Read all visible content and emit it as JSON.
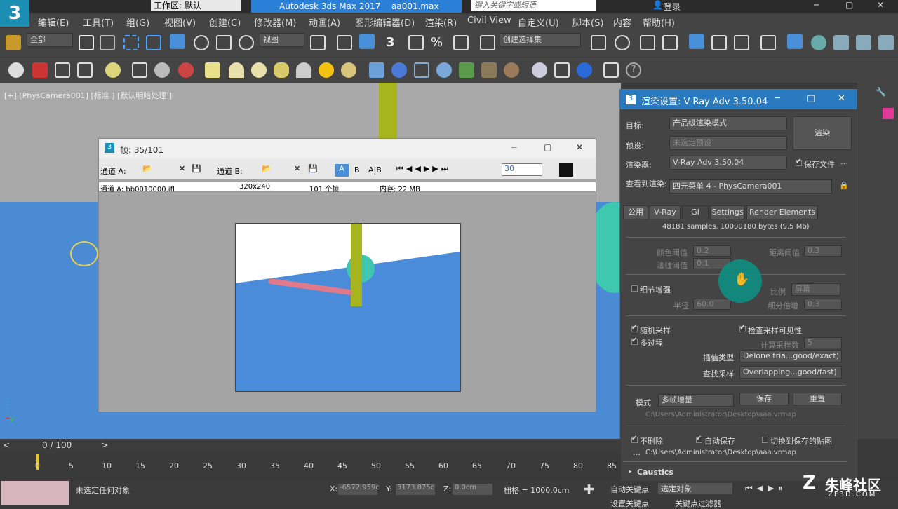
{
  "titlebar": {
    "workspace_label": "工作区: 默认",
    "app_title": "Autodesk 3ds Max 2017",
    "file": "aa001.max",
    "search_placeholder": "键入关键字或短语",
    "login": "登录"
  },
  "menu": [
    "编辑(E)",
    "工具(T)",
    "组(G)",
    "视图(V)",
    "创建(C)",
    "修改器(M)",
    "动画(A)",
    "图形编辑器(D)",
    "渲染(R)",
    "Civil View",
    "自定义(U)",
    "脚本(S)",
    "内容",
    "帮助(H)"
  ],
  "toolbar": {
    "filter": "全部",
    "ref_coord": "视图",
    "selection_set": "创建选择集"
  },
  "viewport": {
    "label": "[+] [PhysCamera001] [标准 ] [默认明暗处理 ]"
  },
  "frame_window": {
    "title": "帧: 35/101",
    "channel_a": "通道 A:",
    "channel_b": "通道 B:",
    "btn_a": "A",
    "btn_b": "B",
    "btn_ab": "A|B",
    "frame_num": "30",
    "info_file": "通道 A: bb0010000.ifl",
    "info_res": "320x240",
    "info_frames": "101 个帧",
    "info_mem": "内存: 22 MB"
  },
  "render_dialog": {
    "title": "渲染设置: V-Ray Adv 3.50.04",
    "target_label": "目标:",
    "target_value": "产品级渲染模式",
    "preset_label": "预设:",
    "preset_value": "未选定预设",
    "renderer_label": "渲染器:",
    "renderer_value": "V-Ray Adv 3.50.04",
    "save_file": "保存文件",
    "view_label": "查看到渲染:",
    "view_value": "四元菜单 4 - PhysCamera001",
    "render_button": "渲染",
    "tabs": [
      "公用",
      "V-Ray",
      "GI",
      "Settings",
      "Render Elements"
    ],
    "samples_text": "48181 samples, 10000180 bytes (9.5 Mb)",
    "color_thresh_label": "颜色阈值",
    "color_thresh": "0.2",
    "dist_thresh_label": "距离阈值",
    "dist_thresh": "0.3",
    "normal_thresh_label": "法线阈值",
    "normal_thresh": "0.1",
    "detail_enh": "细节增强",
    "scale_label": "比例",
    "scale_value": "屏幕",
    "radius_label": "半径",
    "radius": "60.0",
    "subdiv_mult_label": "细分倍增",
    "subdiv_mult": "0.3",
    "random_sample": "随机采样",
    "check_visibility": "检查采样可见性",
    "multipass": "多过程",
    "calc_passes_label": "计算采样数",
    "calc_passes": "5",
    "interp_label": "插值类型",
    "interp_value": "Delone tria...good/exact)",
    "lookup_label": "查找采样",
    "lookup_value": "Overlapping...good/fast)",
    "mode_label": "模式",
    "mode_value": "多帧增量",
    "save_btn": "保存",
    "reset_btn": "重置",
    "path1": "C:\\Users\\Administrator\\Desktop\\aaa.vrmap",
    "no_delete": "不删除",
    "auto_save": "自动保存",
    "switch_saved": "切换到保存的贴图",
    "path2": "C:\\Users\\Administrator\\Desktop\\aaa.vrmap",
    "caustics": "Caustics"
  },
  "timeline": {
    "position": "0 / 100",
    "ticks": [
      "0",
      "5",
      "10",
      "15",
      "20",
      "25",
      "30",
      "35",
      "40",
      "45",
      "50",
      "55",
      "60",
      "65",
      "70",
      "75",
      "80",
      "85"
    ]
  },
  "status": {
    "selection": "未选定任何对象",
    "x_label": "X:",
    "x": "-6572.959c",
    "y_label": "Y:",
    "y": "3173.875c",
    "z_label": "Z:",
    "z": "0.0cm",
    "grid": "栅格 = 1000.0cm",
    "auto_key": "自动关键点",
    "select_object": "选定对象",
    "set_key": "设置关键点",
    "key_filter": "关键点过滤器"
  },
  "watermark": {
    "text": "朱峰社区",
    "sub": "ZF3D.COM"
  }
}
